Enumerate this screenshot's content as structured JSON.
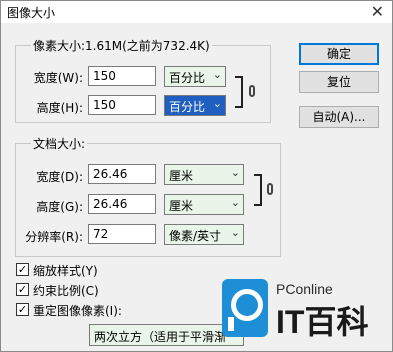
{
  "window": {
    "title": "图像大小",
    "close_glyph": "✕"
  },
  "pixel_dimensions": {
    "legend": "像素大小:1.61M(之前为732.4K)",
    "width_label": "宽度(W):",
    "width_value": "150",
    "width_unit": "百分比",
    "height_label": "高度(H):",
    "height_value": "150",
    "height_unit": "百分比"
  },
  "document_size": {
    "legend": "文档大小:",
    "width_label": "宽度(D):",
    "width_value": "26.46",
    "width_unit": "厘米",
    "height_label": "高度(G):",
    "height_value": "26.46",
    "height_unit": "厘米",
    "resolution_label": "分辨率(R):",
    "resolution_value": "72",
    "resolution_unit": "像素/英寸"
  },
  "buttons": {
    "ok": "确定",
    "reset": "复位",
    "auto": "自动(A)..."
  },
  "options": {
    "scale_styles": {
      "label": "缩放样式(Y)",
      "checked": true
    },
    "constrain": {
      "label": "约束比例(C)",
      "checked": true
    },
    "resample": {
      "label": "重定图像像素(I):",
      "checked": true
    },
    "resample_method": "两次立方（适用于平滑渐"
  },
  "watermark": {
    "small": "PConline",
    "large": "IT百科",
    "color": "#1e8fd6"
  }
}
